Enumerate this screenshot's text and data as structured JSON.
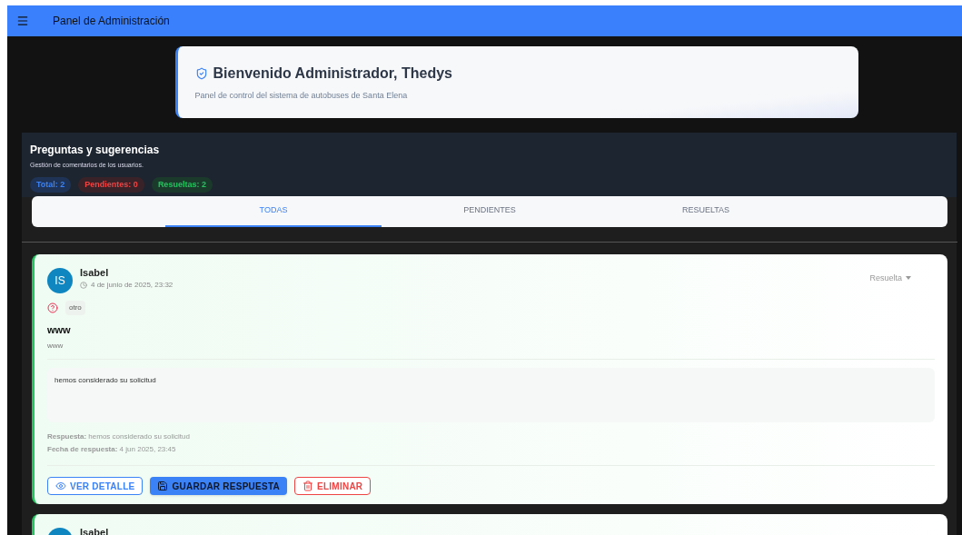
{
  "header": {
    "title": "Panel de Administración"
  },
  "welcome": {
    "title": "Bienvenido Administrador, Thedys",
    "subtitle": "Panel de control del sistema de autobuses de Santa Elena"
  },
  "section": {
    "title": "Preguntas y sugerencias",
    "subtitle": "Gestión de comentarios de los usuarios.",
    "counters": [
      {
        "label": "Total: 2",
        "kind": "total"
      },
      {
        "label": "Pendientes: 0",
        "kind": "pending"
      },
      {
        "label": "Resueltas: 2",
        "kind": "resolved"
      }
    ]
  },
  "tabs": [
    {
      "label": "TODAS",
      "selected": true
    },
    {
      "label": "PENDIENTES",
      "selected": false
    },
    {
      "label": "RESUELTAS",
      "selected": false
    }
  ],
  "items": [
    {
      "author": "Isabel",
      "initials": "IS",
      "date": "4 de junio de 2025, 23:32",
      "status": "Resuelta",
      "category": "otro",
      "title": "www",
      "body": "www",
      "reply_value": "hemos considerado su solicitud",
      "reply_label": "Respuesta:",
      "reply_text": "hemos considerado su solicitud",
      "reply_date_label": "Fecha de respuesta:",
      "reply_date": "4 jun 2025, 23:45",
      "actions": [
        {
          "kind": "view",
          "label": "VER DETALLE"
        },
        {
          "kind": "save",
          "label": "GUARDAR RESPUESTA"
        },
        {
          "kind": "delete",
          "label": "ELIMINAR"
        }
      ]
    },
    {
      "author": "Isabel"
    }
  ]
}
